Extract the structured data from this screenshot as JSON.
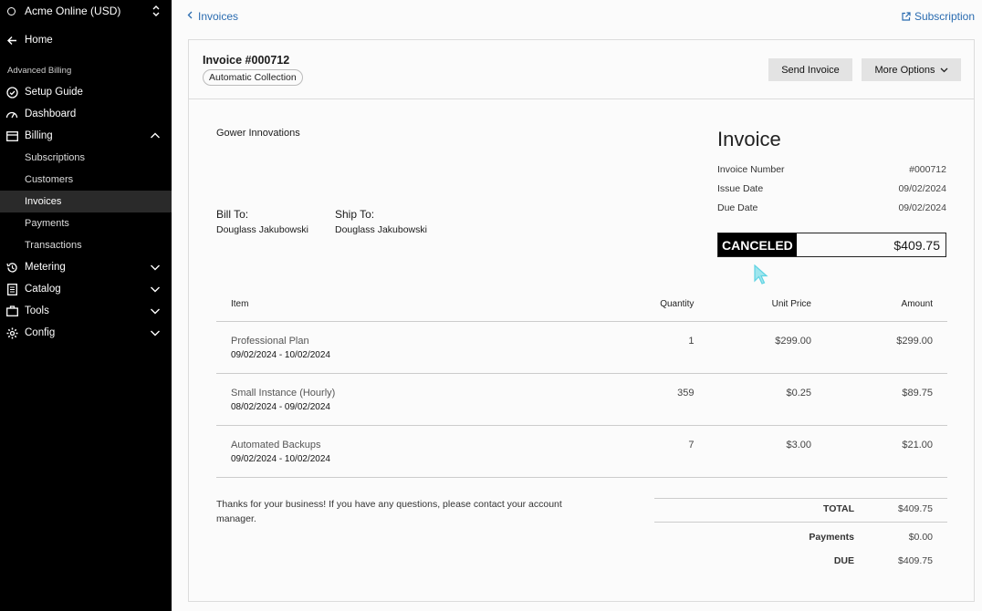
{
  "sidebar": {
    "org_name": "Acme Online (USD)",
    "home": "Home",
    "section": "Advanced Billing",
    "items": {
      "setup_guide": "Setup Guide",
      "dashboard": "Dashboard",
      "billing": "Billing",
      "metering": "Metering",
      "catalog": "Catalog",
      "tools": "Tools",
      "config": "Config"
    },
    "billing_sub": {
      "subscriptions": "Subscriptions",
      "customers": "Customers",
      "invoices": "Invoices",
      "payments": "Payments",
      "transactions": "Transactions"
    }
  },
  "topbar": {
    "back_label": "Invoices",
    "subscription_link": "Subscription"
  },
  "invoice_header": {
    "title": "Invoice #000712",
    "badge": "Automatic Collection",
    "send_button": "Send Invoice",
    "more_button": "More Options"
  },
  "invoice": {
    "company": "Gower Innovations",
    "heading": "Invoice",
    "bill_to_label": "Bill To:",
    "bill_to_name": "Douglass Jakubowski",
    "ship_to_label": "Ship To:",
    "ship_to_name": "Douglass Jakubowski",
    "meta": {
      "number_label": "Invoice Number",
      "number": "#000712",
      "issue_label": "Issue Date",
      "issue_date": "09/02/2024",
      "due_label": "Due Date",
      "due_date": "09/02/2024"
    },
    "status": "CANCELED",
    "status_amount": "$409.75",
    "columns": {
      "item": "Item",
      "quantity": "Quantity",
      "unit_price": "Unit Price",
      "amount": "Amount"
    },
    "lines": [
      {
        "name": "Professional Plan",
        "period": "09/02/2024 - 10/02/2024",
        "quantity": "1",
        "unit_price": "$299.00",
        "amount": "$299.00"
      },
      {
        "name": "Small Instance (Hourly)",
        "period": "08/02/2024 - 09/02/2024",
        "quantity": "359",
        "unit_price": "$0.25",
        "amount": "$89.75"
      },
      {
        "name": "Automated Backups",
        "period": "09/02/2024 - 10/02/2024",
        "quantity": "7",
        "unit_price": "$3.00",
        "amount": "$21.00"
      }
    ],
    "note": "Thanks for your business! If you have any questions, please contact your account manager.",
    "totals": {
      "total_label": "TOTAL",
      "total": "$409.75",
      "payments_label": "Payments",
      "payments": "$0.00",
      "due_label": "DUE",
      "due": "$409.75"
    }
  },
  "colors": {
    "sidebar_bg": "#000000",
    "link": "#2b6cb0",
    "status_bg": "#000000",
    "cursor": "#5fd3e3"
  }
}
